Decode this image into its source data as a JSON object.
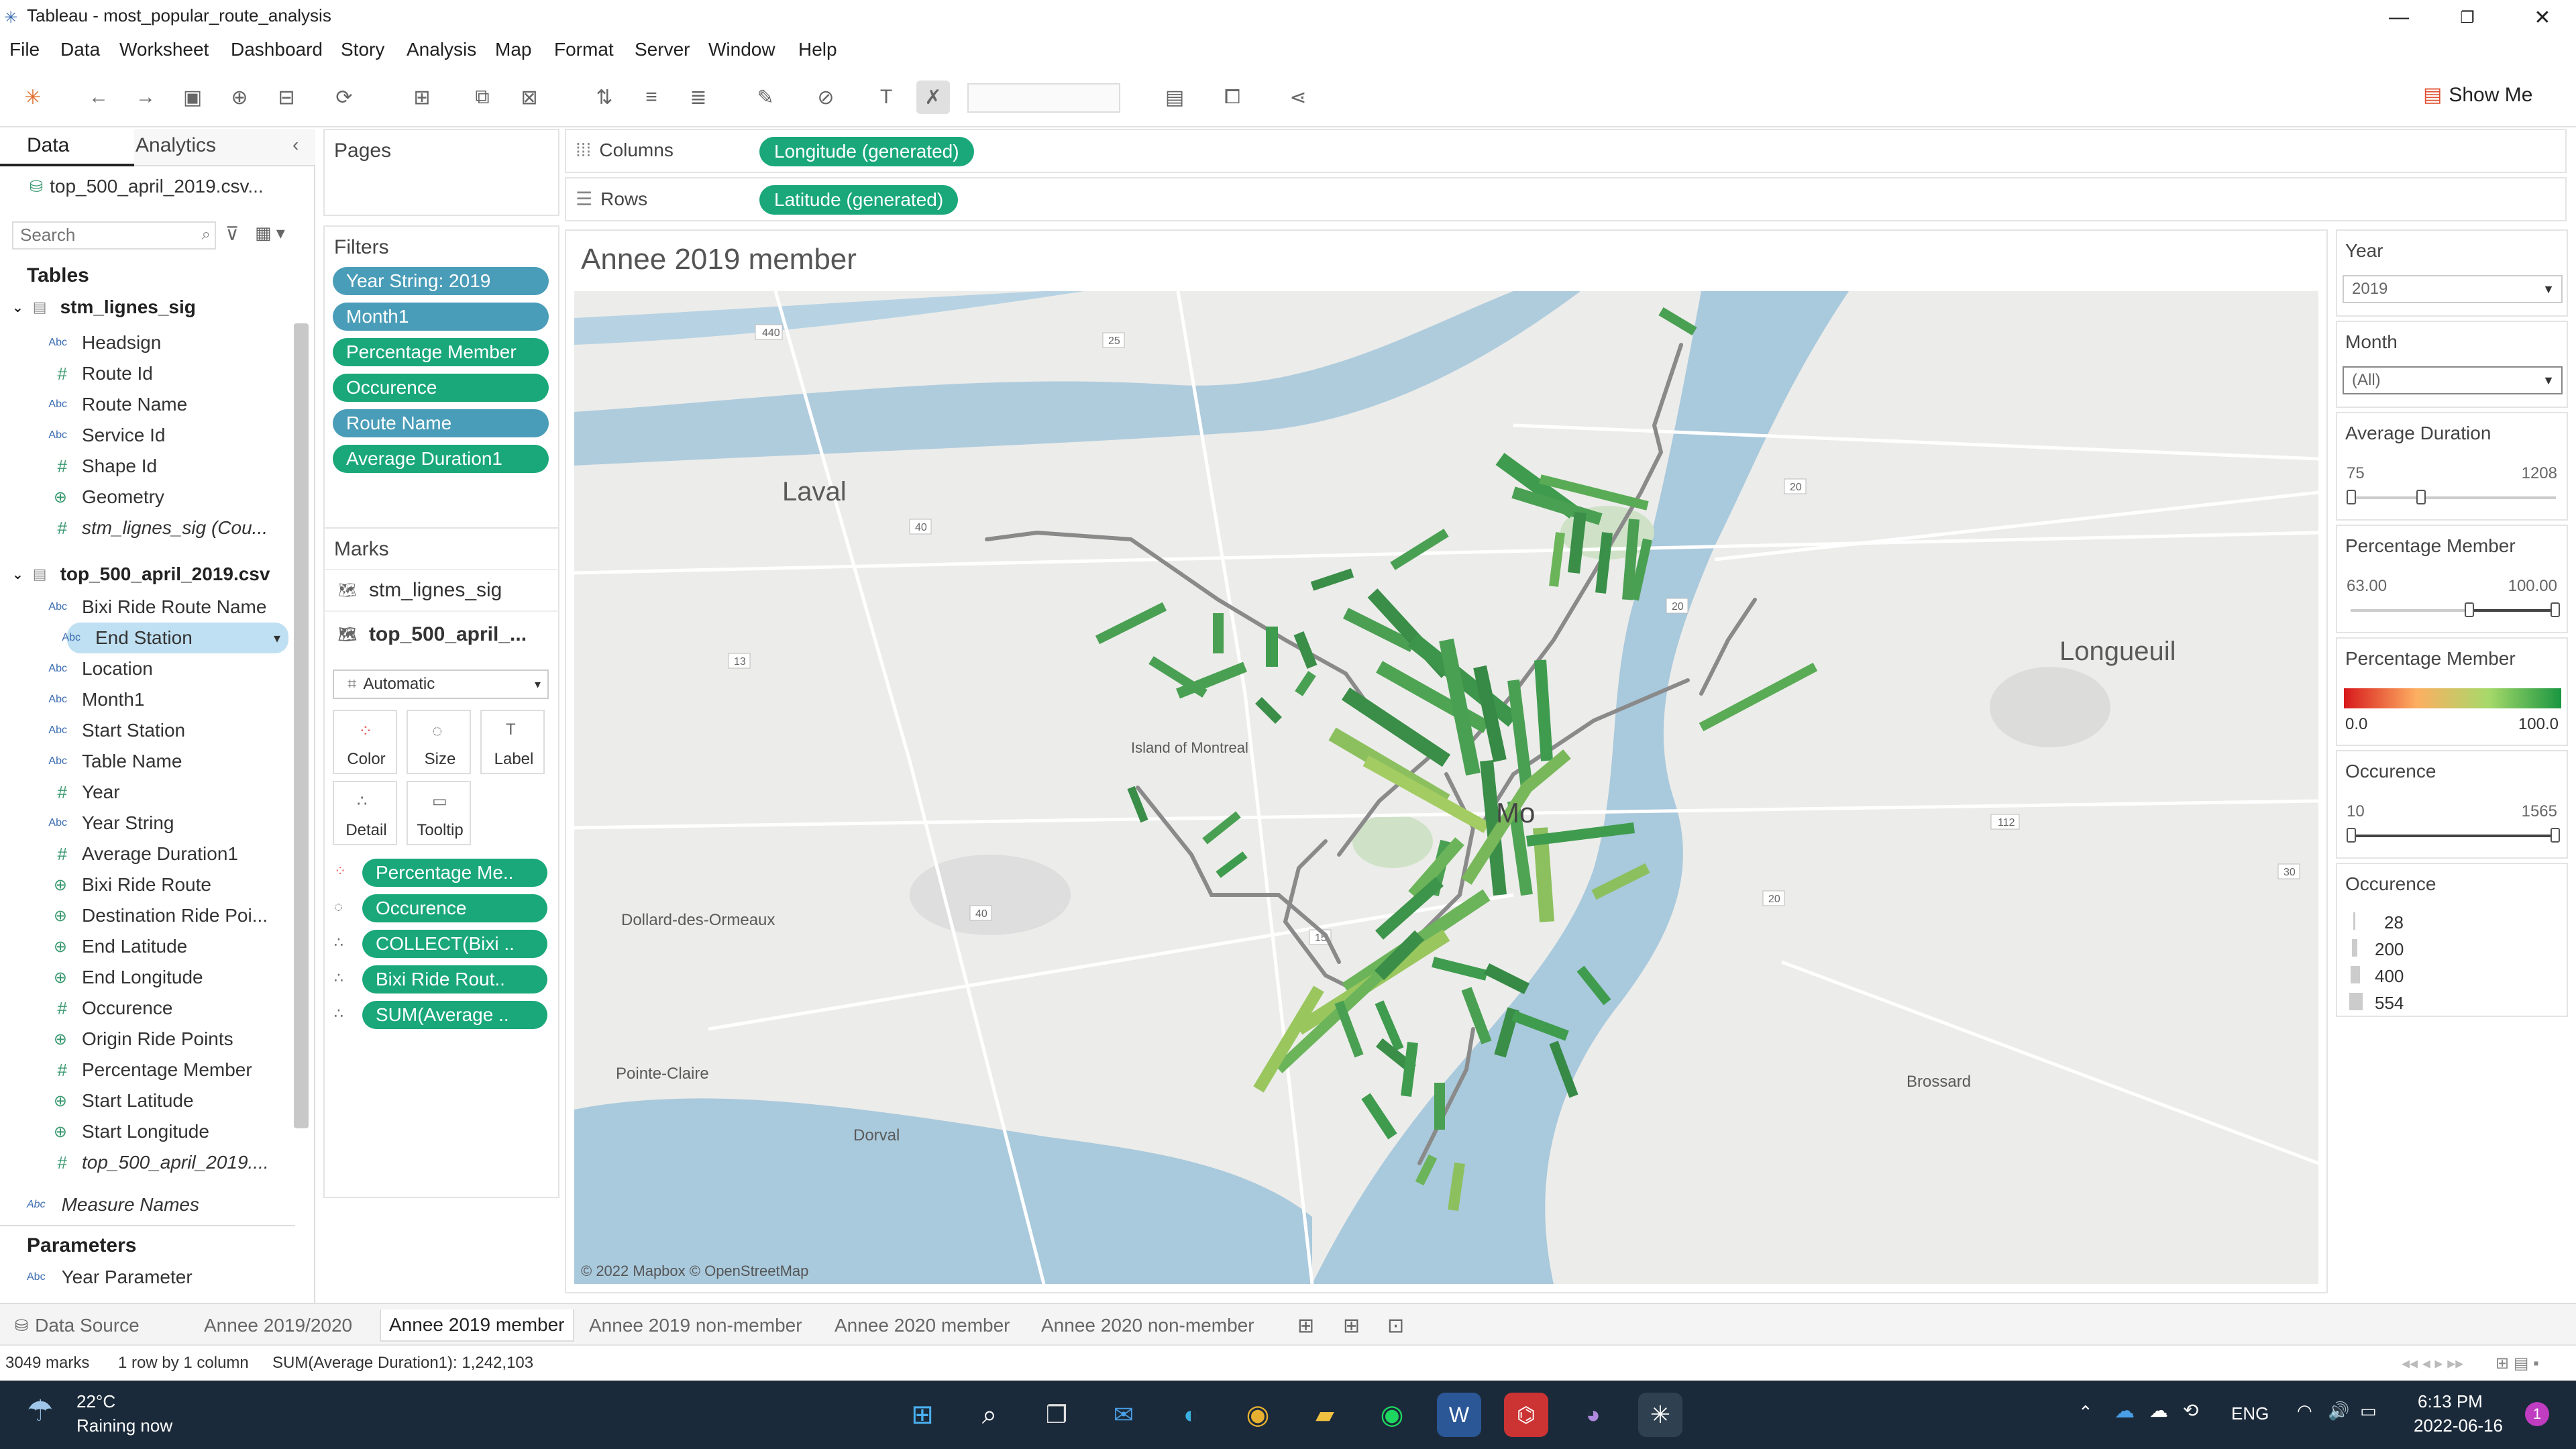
{
  "window": {
    "title": "Tableau - most_popular_route_analysis"
  },
  "menu": [
    "File",
    "Data",
    "Worksheet",
    "Dashboard",
    "Story",
    "Analysis",
    "Map",
    "Format",
    "Server",
    "Window",
    "Help"
  ],
  "toolbar": {
    "show_me": "Show Me"
  },
  "left_panel": {
    "tabs": [
      "Data",
      "Analytics"
    ],
    "datasource": "top_500_april_2019.csv...",
    "search_placeholder": "Search",
    "tables_header": "Tables",
    "table1": {
      "name": "stm_lignes_sig",
      "fields": [
        {
          "label": "Headsign",
          "type": "abc"
        },
        {
          "label": "Route Id",
          "type": "hash"
        },
        {
          "label": "Route Name",
          "type": "abc"
        },
        {
          "label": "Service Id",
          "type": "abc"
        },
        {
          "label": "Shape Id",
          "type": "hash"
        },
        {
          "label": "Geometry",
          "type": "globe"
        },
        {
          "label": "stm_lignes_sig (Cou...",
          "type": "hash",
          "italic": true
        }
      ]
    },
    "table2": {
      "name": "top_500_april_2019.csv",
      "fields": [
        {
          "label": "Bixi Ride Route Name",
          "type": "abc"
        },
        {
          "label": "End Station",
          "type": "abc",
          "selected": true
        },
        {
          "label": "Location",
          "type": "abc"
        },
        {
          "label": "Month1",
          "type": "abc"
        },
        {
          "label": "Start Station",
          "type": "abc"
        },
        {
          "label": "Table Name",
          "type": "abc"
        },
        {
          "label": "Year",
          "type": "hash"
        },
        {
          "label": "Year String",
          "type": "abc"
        },
        {
          "label": "Average Duration1",
          "type": "hash"
        },
        {
          "label": "Bixi Ride Route",
          "type": "globe"
        },
        {
          "label": "Destination Ride Poi...",
          "type": "globe"
        },
        {
          "label": "End Latitude",
          "type": "globe"
        },
        {
          "label": "End Longitude",
          "type": "globe"
        },
        {
          "label": "Occurence",
          "type": "hash"
        },
        {
          "label": "Origin Ride Points",
          "type": "globe"
        },
        {
          "label": "Percentage Member",
          "type": "hash"
        },
        {
          "label": "Start Latitude",
          "type": "globe"
        },
        {
          "label": "Start Longitude",
          "type": "globe"
        },
        {
          "label": "top_500_april_2019....",
          "type": "hash",
          "italic": true
        }
      ]
    },
    "measure_names": "Measure Names",
    "parameters_header": "Parameters",
    "parameter": "Year Parameter"
  },
  "pages": {
    "title": "Pages"
  },
  "filters": {
    "title": "Filters",
    "pills": [
      {
        "label": "Year String: 2019",
        "color": "blue"
      },
      {
        "label": "Month1",
        "color": "blue"
      },
      {
        "label": "Percentage Member",
        "color": "green"
      },
      {
        "label": "Occurence",
        "color": "green"
      },
      {
        "label": "Route Name",
        "color": "blue"
      },
      {
        "label": "Average Duration1",
        "color": "green"
      }
    ]
  },
  "marks": {
    "title": "Marks",
    "layers": [
      "stm_lignes_sig",
      "top_500_april_..."
    ],
    "mark_type": "Automatic",
    "buttons": [
      "Color",
      "Size",
      "Label",
      "Detail",
      "Tooltip"
    ],
    "pills": [
      {
        "label": "Percentage Me..",
        "icon": "color"
      },
      {
        "label": "Occurence",
        "icon": "size"
      },
      {
        "label": "COLLECT(Bixi ..",
        "icon": "detail"
      },
      {
        "label": "Bixi Ride Rout..",
        "icon": "detail"
      },
      {
        "label": "SUM(Average ..",
        "icon": "detail"
      }
    ]
  },
  "shelves": {
    "columns_label": "Columns",
    "columns_pill": "Longitude (generated)",
    "rows_label": "Rows",
    "rows_pill": "Latitude (generated)"
  },
  "viz": {
    "title": "Annee 2019 member",
    "map_labels": [
      "Laval",
      "Longueuil",
      "Island of Montreal",
      "Dollard-des-Ormeaux",
      "Pointe-Claire",
      "Dorval",
      "Brossard",
      "Mo"
    ],
    "road_numbers": [
      "440",
      "25",
      "40",
      "20",
      "13",
      "20",
      "40",
      "15",
      "112",
      "20",
      "30"
    ],
    "attribution": "© 2022 Mapbox © OpenStreetMap"
  },
  "right_panel": {
    "year": {
      "title": "Year",
      "value": "2019"
    },
    "month": {
      "title": "Month",
      "value": "(All)"
    },
    "avg_duration": {
      "title": "Average Duration",
      "min": "75",
      "max": "1208"
    },
    "pct_member_filter": {
      "title": "Percentage Member",
      "min": "63.00",
      "max": "100.00"
    },
    "pct_member_legend": {
      "title": "Percentage Member",
      "min": "0.0",
      "max": "100.0",
      "colors": [
        "#d7191c",
        "#fdae61",
        "#a6d96a",
        "#1a9641"
      ]
    },
    "occurence_filter": {
      "title": "Occurence",
      "min": "10",
      "max": "1565"
    },
    "occurence_legend": {
      "title": "Occurence",
      "sizes": [
        "28",
        "200",
        "400",
        "554"
      ]
    }
  },
  "sheet_tabs": [
    "Data Source",
    "Annee 2019/2020",
    "Annee 2019 member",
    "Annee 2019 non-member",
    "Annee 2020 member",
    "Annee 2020 non-member"
  ],
  "active_tab": "Annee 2019 member",
  "status": {
    "marks": "3049 marks",
    "rows": "1 row by 1 column",
    "sum": "SUM(Average Duration1): 1,242,103"
  },
  "taskbar": {
    "weather_temp": "22°C",
    "weather_desc": "Raining now",
    "lang": "ENG",
    "time": "6:13 PM",
    "date": "2022-06-16",
    "notif": "1"
  }
}
